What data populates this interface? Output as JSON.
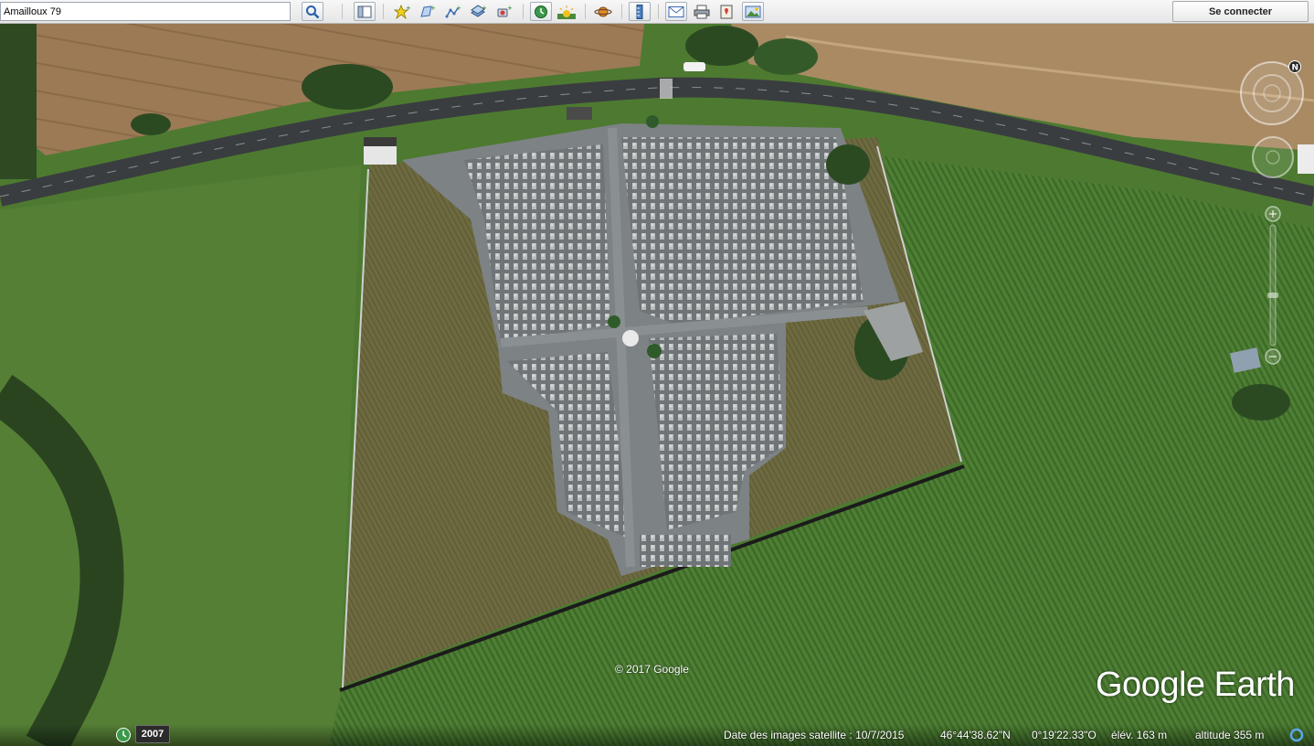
{
  "search": {
    "value": "Amailloux 79"
  },
  "toolbar": {
    "search_button_icon": "search-icon",
    "icons": [
      "sidebar-icon",
      "placemark-icon",
      "polygon-icon",
      "path-icon",
      "overlay-icon",
      "tour-icon",
      "history-icon",
      "sunlight-icon",
      "planet-icon",
      "ruler-icon",
      "email-icon",
      "print-icon",
      "maps-icon",
      "save-image-icon"
    ],
    "connect_label": "Se connecter"
  },
  "map": {
    "copyright": "© 2017 Google",
    "logo": "Google Earth",
    "imagery_year": "2007",
    "status": {
      "imagery_date": "Date des images satellite : 10/7/2015",
      "latitude": "46°44'38.62\"N",
      "longitude": "0°19'22.33\"O",
      "elevation": "élév.  163 m",
      "altitude": "altitude    355 m"
    }
  },
  "colors": {
    "field_green": "#4f7a32",
    "crop_field": "#9a7a55",
    "road": "#3a3d40",
    "cemetery_gravel": "#7d8285",
    "lawn": "#6b6a3f"
  }
}
